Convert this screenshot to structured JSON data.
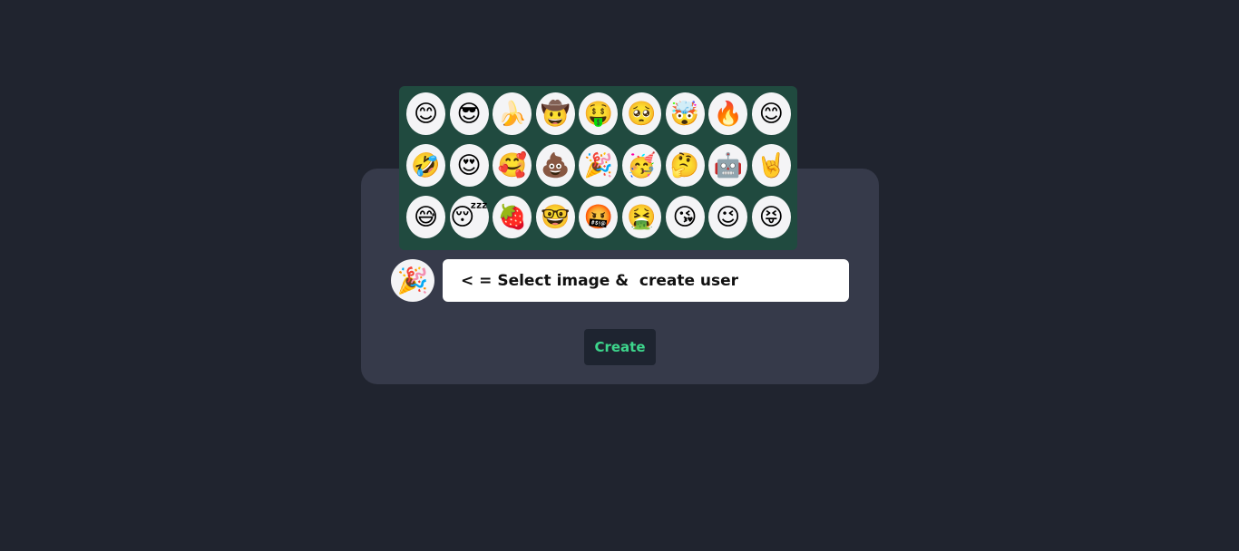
{
  "colors": {
    "page_background": "#20242f",
    "card_background": "#363a4a",
    "picker_background": "#204a3f",
    "emoji_cell_background": "#f4f4f6",
    "button_background": "#1e2430",
    "button_text": "#3dd68c"
  },
  "emoji_picker": {
    "emojis": [
      "😊",
      "😎",
      "🍌",
      "🤠",
      "🤑",
      "🥺",
      "🤯",
      "🔥",
      "😊",
      "🤣",
      "😍",
      "🥰",
      "💩",
      "🎉",
      "🥳",
      "🤔",
      "🤖",
      "🤘",
      "😅",
      "😴",
      "🍓",
      "🤓",
      "🤬",
      "🤮",
      "😘",
      "😉",
      "😝"
    ]
  },
  "selected_avatar": "🎉",
  "username_field": {
    "value": "",
    "placeholder": "< = Select image &  create user"
  },
  "create_button": {
    "label": "Create"
  }
}
